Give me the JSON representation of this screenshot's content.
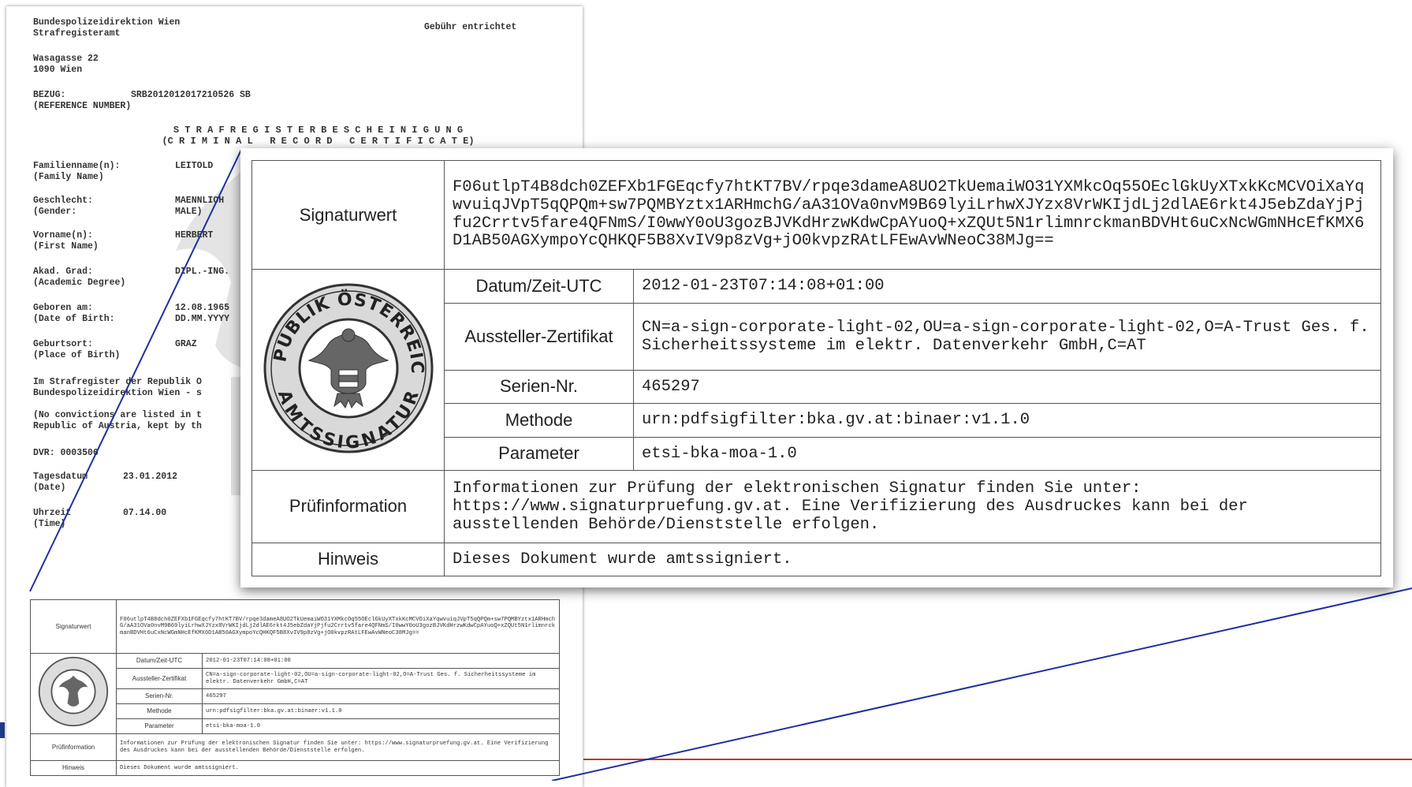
{
  "document": {
    "authority_line1": "Bundespolizeidirektion Wien",
    "authority_line2": "Strafregisteramt",
    "fee": "Gebühr entrichtet",
    "address_line1": "Wasagasse 22",
    "address_line2": "1090 Wien",
    "reference_label": "BEZUG:",
    "reference_value": "SRB2012012017210526 SB",
    "reference_label_en": "(REFERENCE NUMBER)",
    "title_de": "S T R A F R E G I S T E R B E S C H E I N I G U N G",
    "title_en": "(C R I M I N A L   R E C O R D   C E R T I F I C A T E)",
    "fields": [
      {
        "label": "Familienname(n):",
        "label_en": "(Family Name)",
        "value": "LEITOLD",
        "value2": ""
      },
      {
        "label": "Geschlecht:",
        "label_en": "(Gender:",
        "value": "MAENNLICH",
        "value2": "MALE)"
      },
      {
        "label": "Vorname(n):",
        "label_en": "(First Name)",
        "value": "HERBERT",
        "value2": ""
      },
      {
        "label": "Akad. Grad:",
        "label_en": "(Academic Degree)",
        "value": "DIPL.-ING.",
        "value2": ""
      },
      {
        "label": "Geboren am:",
        "label_en": "(Date of Birth:",
        "value": "12.08.1965",
        "value2": "DD.MM.YYYY"
      },
      {
        "label": "Geburtsort:",
        "label_en": "(Place of Birth)",
        "value": "GRAZ",
        "value2": ""
      }
    ],
    "statement_line1": "Im Strafregister der Republik O",
    "statement_line2": "Bundespolizeidirektion Wien - s",
    "statement_en_line1": "(No convictions are listed in t",
    "statement_en_line2": "Republic of Austria, kept by th",
    "dvr": "DVR: 0003506",
    "date_label": "Tagesdatum",
    "date_label_en": "(Date)",
    "date_value": "23.01.2012",
    "time_label": "Uhrzeit",
    "time_label_en": "(Time)",
    "time_value": "07.14.00"
  },
  "signature_block": {
    "signaturwert_label": "Signaturwert",
    "signaturwert_value": "F06utlpT4B8dch0ZEFXb1FGEqcfy7htKT7BV/rpqe3dameA8UO2TkUemaiWO31YXMkcOq55OEclGkUyXTxkKcMCVOiXaYqwvuiqJVpT5qQPQm+sw7PQMBYztx1ARHmchG/aA31OVa0nvM9B69lyiLrhwXJYzx8VrWKIjdLj2dlAE6rkt4J5ebZdaYjPjfu2Crrtv5fare4QFNmS/I0wwY0oU3gozBJVKdHrzwKdwCpAYuoQ+xZQUt5N1rlimnrckmanBDVHt6uCxNcWGmNHcEfKMX6D1AB50AGXympoYcQHKQF5B8XvIV9p8zVg+jO0kvpzRAtLFEwAvWNeoC38MJg==",
    "seal_top": "REPUBLIK ÖSTERREICH",
    "seal_bottom": "AMTSSIGNATUR",
    "rows": [
      {
        "label": "Datum/Zeit-UTC",
        "value": "2012-01-23T07:14:08+01:00"
      },
      {
        "label": "Aussteller-Zertifikat",
        "value": "CN=a-sign-corporate-light-02,OU=a-sign-corporate-light-02,O=A-Trust Ges. f. Sicherheitssysteme im elektr. Datenverkehr GmbH,C=AT"
      },
      {
        "label": "Serien-Nr.",
        "value": "465297"
      },
      {
        "label": "Methode",
        "value": "urn:pdfsigfilter:bka.gv.at:binaer:v1.1.0"
      },
      {
        "label": "Parameter",
        "value": "etsi-bka-moa-1.0"
      }
    ],
    "pruef_label": "Prüfinformation",
    "pruef_value": "Informationen zur Prüfung der elektronischen Signatur finden Sie unter: https://www.signaturpruefung.gv.at. Eine Verifizierung des Ausdruckes kann bei der ausstellenden Behörde/Dienststelle erfolgen.",
    "hinweis_label": "Hinweis",
    "hinweis_value": "Dieses Dokument wurde amtssigniert."
  },
  "colors": {
    "zoom_line": "#1f2f9e",
    "slide_rule": "#c0392b",
    "border": "#555555"
  }
}
